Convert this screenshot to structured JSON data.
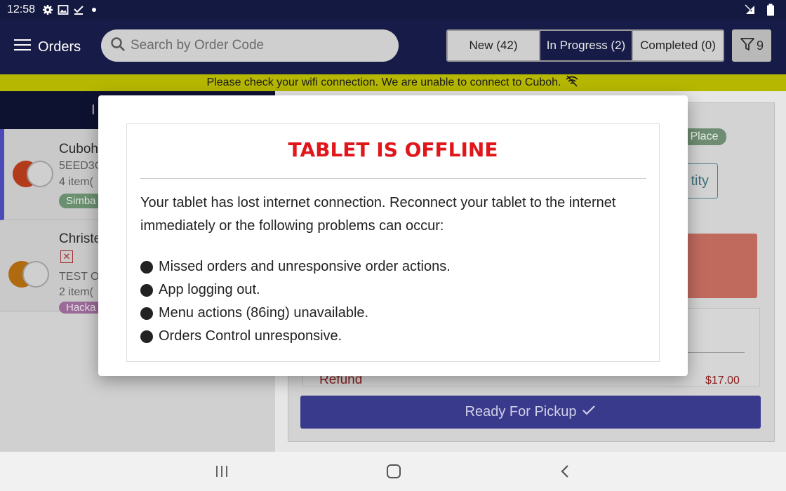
{
  "status_bar": {
    "time": "12:58",
    "left_icons": [
      "gear-icon",
      "image-icon",
      "download-done-icon",
      "dot-icon"
    ],
    "right_icons": [
      "no-signal-icon",
      "battery-icon"
    ]
  },
  "app_bar": {
    "title": "Orders",
    "search_placeholder": "Search by Order Code",
    "tabs": [
      {
        "label": "New (42)",
        "active": false
      },
      {
        "label": "In Progress (2)",
        "active": true
      },
      {
        "label": "Completed (0)",
        "active": false
      }
    ],
    "filter_count": "9"
  },
  "banner": {
    "text": "Please check your wifi connection. We are unable to connect to Cuboh."
  },
  "left_panel": {
    "header": "I",
    "orders": [
      {
        "name": "Cuboh",
        "code": "5EED3C",
        "items": "4 item(",
        "tag": "Simba"
      },
      {
        "name": "Christe",
        "code": "TEST O",
        "items": "2 item(",
        "tag": "Hacka"
      }
    ]
  },
  "right_panel": {
    "tag": "s Place",
    "qty_label": "tity",
    "refund_label": "Refund",
    "refund_amount": "$17.00",
    "ready_button": "Ready For Pickup"
  },
  "dialog": {
    "title": "TABLET IS OFFLINE",
    "message": "Your tablet has lost internet connection. Reconnect your tablet to the internet immediately or the following problems can occur:",
    "problems": [
      "Missed orders and unresponsive order actions.",
      "App logging out.",
      "Menu actions (86ing) unavailable.",
      "Orders Control unresponsive."
    ]
  },
  "colors": {
    "header_bg": "#161b47",
    "banner_bg": "#b5b700",
    "dialog_title": "#e0161b",
    "ready_button": "#3a3a8c"
  }
}
